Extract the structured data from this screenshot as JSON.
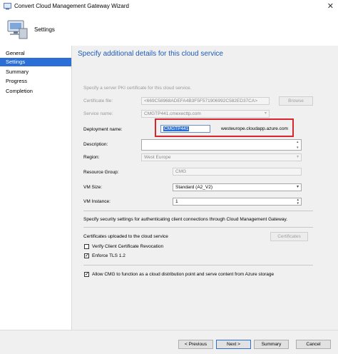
{
  "window": {
    "title": "Convert Cloud Management Gateway Wizard",
    "close_glyph": "✕"
  },
  "header": {
    "page_label": "Settings"
  },
  "nav": {
    "items": [
      "General",
      "Settings",
      "Summary",
      "Progress",
      "Completion"
    ]
  },
  "main": {
    "title": "Specify additional details for this cloud service",
    "cert_intro": "Specify a server PKI certificate for this cloud service.",
    "cert_file_label": "Certificate file:",
    "cert_file_value": "<669C58968ADEFA4B3F5F571906992C582ED37CA>",
    "browse_label": "Browse",
    "service_name_label": "Service name:",
    "service_name_value": "CMGTP441.cmexecttp.com",
    "deployment_name_label": "Deployment name:",
    "deployment_name_value": "CMGTP441",
    "deployment_suffix": "westeurope.cloudapp.azure.com",
    "description_label": "Description:",
    "description_value": "",
    "region_label": "Region:",
    "region_value": "West Europe",
    "resource_group_label": "Resource Group:",
    "resource_group_value": "CMG",
    "vm_size_label": "VM Size:",
    "vm_size_value": "Standard (A2_V2)",
    "vm_instance_label": "VM Instance:",
    "vm_instance_value": "1",
    "security_text": "Specify security settings for authenticating client connections through Cloud Management Gateway.",
    "certs_uploaded_label": "Certificates uploaded to the cloud service",
    "certificates_button": "Certificates",
    "verify_revocation_label": "Verify Client Certificate Revocation",
    "verify_revocation_checked": false,
    "enforce_tls_label": "Enforce TLS 1.2",
    "enforce_tls_checked": true,
    "allow_cdp_label": "Allow CMG to function as a cloud distribution point and serve content from Azure storage",
    "allow_cdp_checked": true
  },
  "footer": {
    "previous": "< Previous",
    "next": "Next >",
    "summary": "Summary",
    "cancel": "Cancel"
  },
  "icons": {
    "checkmark": "✓",
    "dropdown": "▾",
    "spin_up": "▴",
    "spin_down": "▾"
  },
  "colors": {
    "accent": "#2b6fd6",
    "title_blue": "#1e5bb5",
    "highlight_red": "#d9262c"
  }
}
